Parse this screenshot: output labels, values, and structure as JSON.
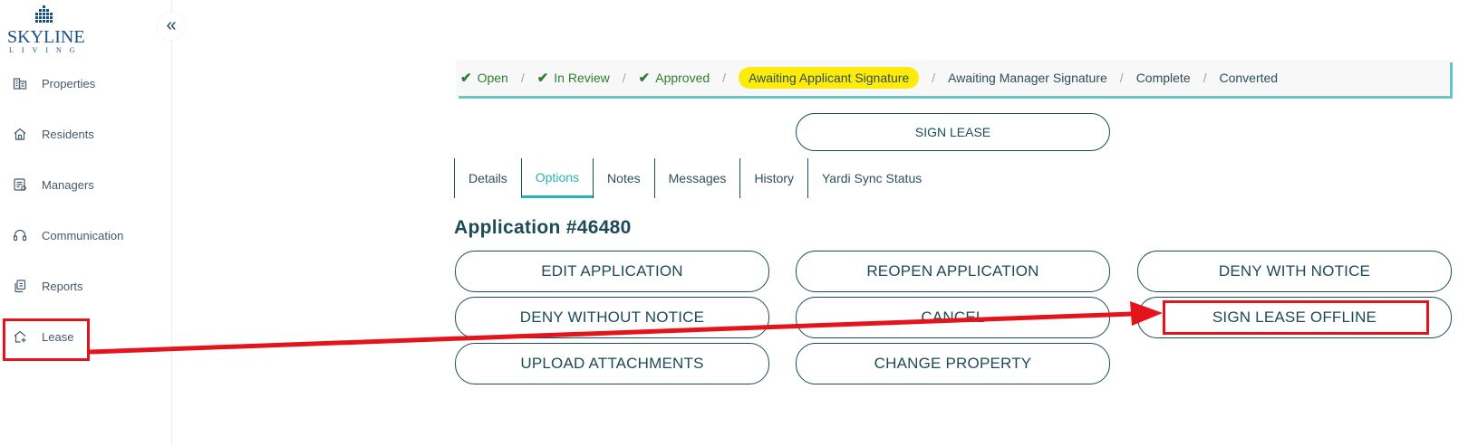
{
  "brand": {
    "name": "Skyline",
    "tagline": "Living"
  },
  "sidebar": {
    "collapse_label": "«",
    "items": [
      {
        "label": "Properties",
        "icon": "building-icon"
      },
      {
        "label": "Residents",
        "icon": "home-icon"
      },
      {
        "label": "Managers",
        "icon": "clipboard-icon"
      },
      {
        "label": "Communication",
        "icon": "headset-icon"
      },
      {
        "label": "Reports",
        "icon": "copy-icon"
      },
      {
        "label": "Lease",
        "icon": "home-sparkle-icon"
      }
    ]
  },
  "status": {
    "steps": [
      {
        "label": "Open",
        "state": "done"
      },
      {
        "label": "In Review",
        "state": "done"
      },
      {
        "label": "Approved",
        "state": "done"
      },
      {
        "label": "Awaiting Applicant Signature",
        "state": "current"
      },
      {
        "label": "Awaiting Manager Signature",
        "state": "pending"
      },
      {
        "label": "Complete",
        "state": "pending"
      },
      {
        "label": "Converted",
        "state": "pending"
      }
    ],
    "separator": "/",
    "colors": {
      "done": "#2e7d32",
      "highlight": "#ffeb0a",
      "accent": "#67c5c6"
    }
  },
  "sign_lease_button": "SIGN LEASE",
  "tabs": [
    "Details",
    "Options",
    "Notes",
    "Messages",
    "History",
    "Yardi Sync Status"
  ],
  "active_tab": "Options",
  "application": {
    "title": "Application #46480",
    "buttons": [
      "EDIT APPLICATION",
      "REOPEN APPLICATION",
      "DENY WITH NOTICE",
      "DENY WITHOUT NOTICE",
      "CANCEL",
      "SIGN LEASE OFFLINE",
      "UPLOAD ATTACHMENTS",
      "CHANGE PROPERTY"
    ]
  },
  "annotation_color": "#e3141b"
}
